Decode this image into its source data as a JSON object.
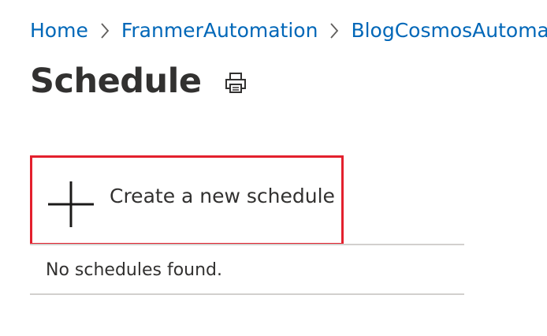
{
  "breadcrumb": {
    "items": [
      {
        "label": "Home"
      },
      {
        "label": "FranmerAutomation"
      },
      {
        "label": "BlogCosmosAutomation"
      }
    ]
  },
  "page": {
    "title": "Schedule",
    "print_icon": "print-icon"
  },
  "create": {
    "label": "Create a new schedule",
    "icon": "plus-icon",
    "highlight_color": "#e3202d"
  },
  "schedules": {
    "empty_message": "No schedules found."
  },
  "colors": {
    "link": "#0067b8",
    "text": "#323130",
    "divider": "#d2d0ce"
  }
}
